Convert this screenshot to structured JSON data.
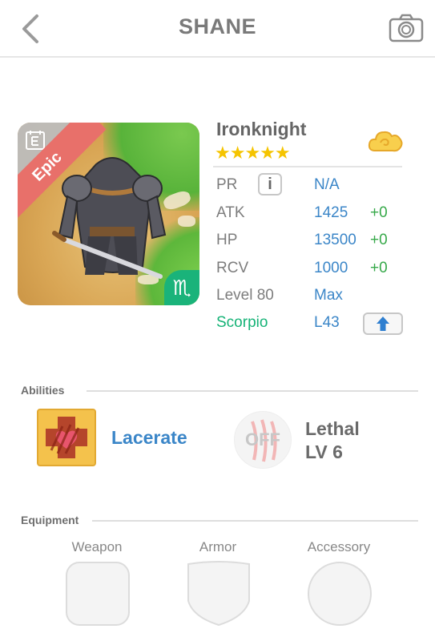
{
  "header": {
    "title": "SHANE",
    "back_icon": "chevron-left-icon",
    "camera_icon": "camera-icon"
  },
  "hero": {
    "name": "Ironknight",
    "stars": "★★★★★",
    "star_count": 5,
    "rarity": "Epic",
    "zodiac_symbol": "♏",
    "type_icon": "cloud-icon",
    "accent": "#3b86c8",
    "bonus_color": "#37a94a",
    "zodiac_color": "#16b377"
  },
  "stats": [
    {
      "label": "PR",
      "value": "N/A",
      "bonus": ""
    },
    {
      "label": "ATK",
      "value": "1425",
      "bonus": "+0"
    },
    {
      "label": "HP",
      "value": "13500",
      "bonus": "+0"
    },
    {
      "label": "RCV",
      "value": "1000",
      "bonus": "+0"
    },
    {
      "label": "Level 80",
      "value": "Max",
      "bonus": ""
    },
    {
      "label": "Scorpio",
      "value": "L43",
      "bonus": ""
    }
  ],
  "abilities": {
    "label": "Abilities",
    "primary": {
      "name": "Lacerate"
    },
    "secondary": {
      "state": "OFF",
      "name": "Lethal",
      "level": "LV 6"
    }
  },
  "equipment": {
    "label": "Equipment",
    "slots": [
      "Weapon",
      "Armor",
      "Accessory"
    ]
  }
}
